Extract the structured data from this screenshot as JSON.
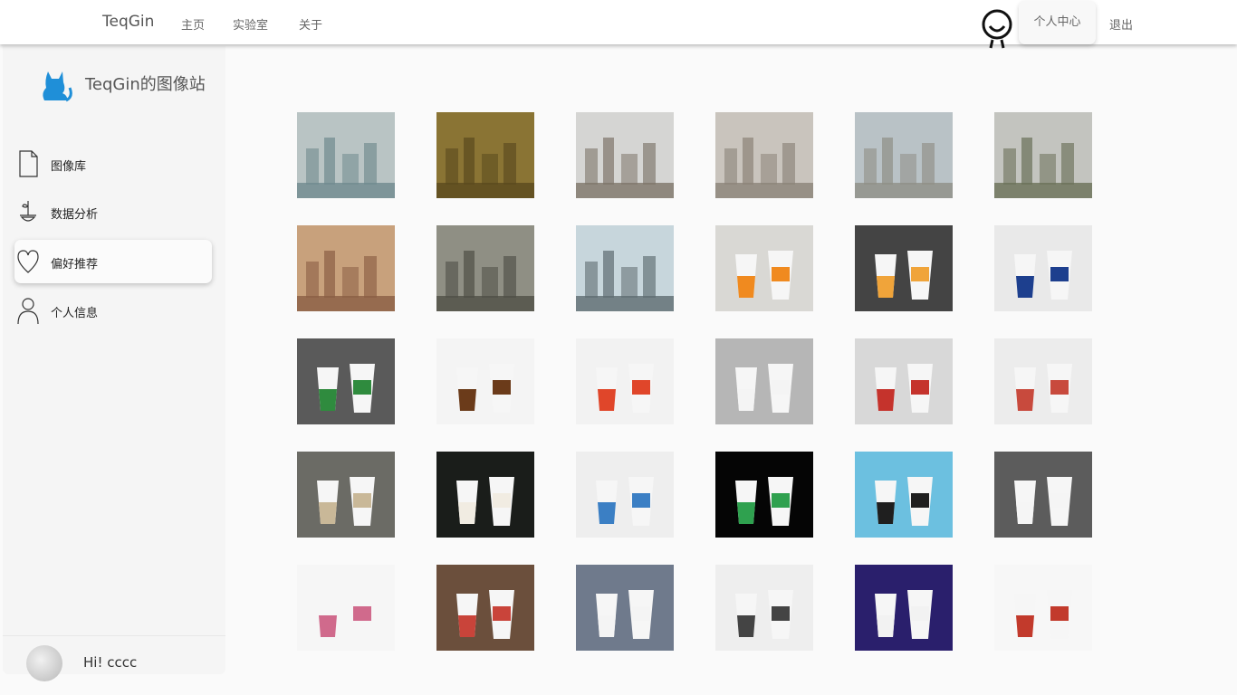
{
  "header": {
    "brand": "TeqGin",
    "nav": [
      {
        "label": "主页"
      },
      {
        "label": "实验室"
      },
      {
        "label": "关于"
      }
    ],
    "user_center": "个人中心",
    "logout": "退出"
  },
  "sidebar": {
    "site_title": "TeqGin的图像站",
    "items": [
      {
        "label": "图像库",
        "icon": "document-icon"
      },
      {
        "label": "数据分析",
        "icon": "plant-icon"
      },
      {
        "label": "偏好推荐",
        "icon": "heart-icon"
      },
      {
        "label": "个人信息",
        "icon": "person-icon"
      }
    ],
    "active_item": "偏好推荐",
    "greeting": "Hi! cccc"
  },
  "gallery": {
    "rows": 5,
    "columns": 6,
    "images": [
      {
        "name": "haze-river-city",
        "bg": "#b9c4c4",
        "fg": "#6f8a8e"
      },
      {
        "name": "sepia-smog-city",
        "bg": "#8a7434",
        "fg": "#5a4a1e"
      },
      {
        "name": "foggy-stadium",
        "bg": "#d5d5d3",
        "fg": "#7d7469"
      },
      {
        "name": "hazy-skyline",
        "bg": "#c9c4bd",
        "fg": "#8b8378"
      },
      {
        "name": "smoggy-towers",
        "bg": "#b9c2c6",
        "fg": "#8f8e86"
      },
      {
        "name": "street-smog",
        "bg": "#c3c4bf",
        "fg": "#6a7058"
      },
      {
        "name": "orange-haze",
        "bg": "#c8a17c",
        "fg": "#8a5e44"
      },
      {
        "name": "grey-tower-fog",
        "bg": "#8f8f84",
        "fg": "#4f4f46"
      },
      {
        "name": "river-view",
        "bg": "#c7d6dc",
        "fg": "#5e6b70"
      },
      {
        "name": "cups-on-desk",
        "bg": "#d9d8d4",
        "fg": "#f08a1f"
      },
      {
        "name": "cup-template-dark",
        "bg": "#444444",
        "fg": "#f0a43a"
      },
      {
        "name": "blue-cup",
        "bg": "#e9e9e9",
        "fg": "#1d3f8e"
      },
      {
        "name": "green-cups",
        "bg": "#5a5a5a",
        "fg": "#2f8b3e"
      },
      {
        "name": "brown-sleeve-cups",
        "bg": "#f4f4f4",
        "fg": "#6b3b1a"
      },
      {
        "name": "red-white-cups",
        "bg": "#f2f2f2",
        "fg": "#e0462a"
      },
      {
        "name": "white-cups-grey",
        "bg": "#b6b6b6",
        "fg": "#f4f4f4"
      },
      {
        "name": "red-pattern-cups",
        "bg": "#d8d8d8",
        "fg": "#c5332c"
      },
      {
        "name": "bowl-stack",
        "bg": "#ececec",
        "fg": "#c84a3d"
      },
      {
        "name": "kraft-cup",
        "bg": "#6b6b65",
        "fg": "#c9b898"
      },
      {
        "name": "floral-cups",
        "bg": "#1a1d1a",
        "fg": "#f1ece2"
      },
      {
        "name": "logo-cups",
        "bg": "#eeeeee",
        "fg": "#3b7fc4"
      },
      {
        "name": "cup-print-black",
        "bg": "#050505",
        "fg": "#2fa14f"
      },
      {
        "name": "drink-cup",
        "bg": "#6cc0e0",
        "fg": "#1f1f1f"
      },
      {
        "name": "cups-gradient",
        "bg": "#5c5c5c",
        "fg": "#f5f5f5"
      },
      {
        "name": "cartoon-cups",
        "bg": "#f6f6f6",
        "fg": "#d06a8c"
      },
      {
        "name": "shelf-cups",
        "bg": "#6b4f3c",
        "fg": "#c9443a"
      },
      {
        "name": "plain-white-cup",
        "bg": "#6f7a8c",
        "fg": "#f4f4f4"
      },
      {
        "name": "foton-cup",
        "bg": "#eeeeee",
        "fg": "#444444"
      },
      {
        "name": "navy-cup-template",
        "bg": "#2a1f6c",
        "fg": "#f2f2f2"
      },
      {
        "name": "multicolor-cups",
        "bg": "#f7f7f7",
        "fg": "#c23a2c"
      }
    ]
  }
}
